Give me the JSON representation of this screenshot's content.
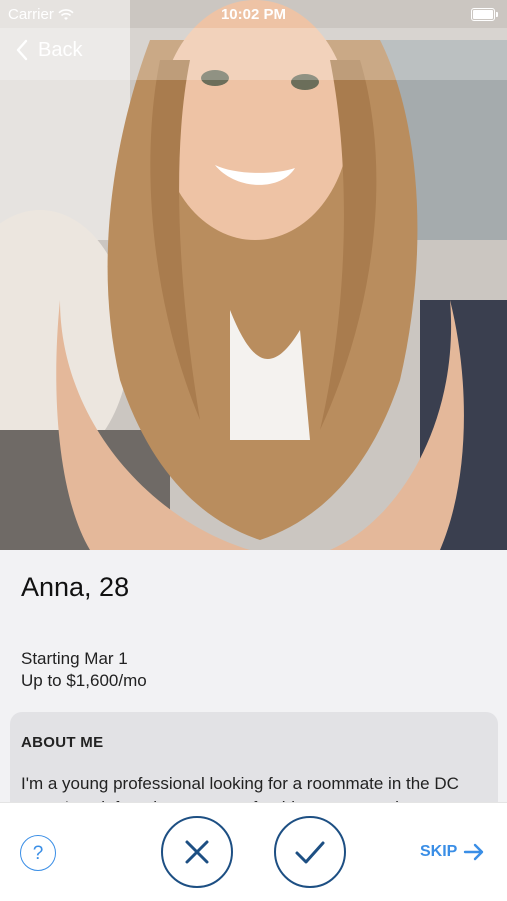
{
  "status_bar": {
    "carrier": "Carrier",
    "time": "10:02 PM",
    "wifi_icon": "wifi-icon",
    "battery_icon": "battery-icon"
  },
  "nav": {
    "back_label": "Back",
    "back_icon": "chevron-left-icon"
  },
  "profile": {
    "photo_alt": "",
    "name_age": "Anna, 28",
    "start": "Starting Mar 1",
    "budget": "Up to $1,600/mo"
  },
  "about": {
    "title": "ABOUT ME",
    "text": "I'm a young professional looking for a roommate in the DC area. I work from home, so preferably someone who"
  },
  "actions": {
    "help_label": "?",
    "reject_icon": "close-icon",
    "accept_icon": "checkmark-icon",
    "skip_label": "SKIP",
    "skip_icon": "arrow-right-icon"
  },
  "colors": {
    "accent": "#3a8ee6",
    "action_border": "#1d4f83",
    "content_bg": "#f2f2f4",
    "card_bg": "#e2e2e5"
  }
}
